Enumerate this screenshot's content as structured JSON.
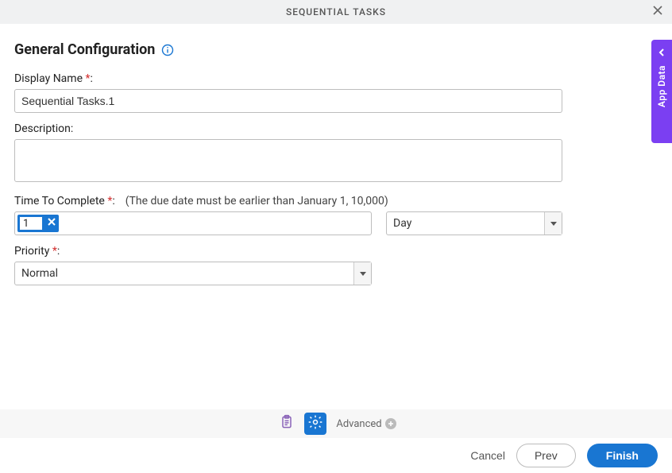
{
  "header": {
    "title": "SEQUENTIAL TASKS"
  },
  "section": {
    "title": "General Configuration"
  },
  "fields": {
    "display_name": {
      "label": "Display Name",
      "value": "Sequential Tasks.1"
    },
    "description": {
      "label": "Description:",
      "value": ""
    },
    "time_to_complete": {
      "label": "Time To Complete",
      "hint": "(The due date must be earlier than January 1, 10,000)",
      "value": "1",
      "unit": "Day"
    },
    "priority": {
      "label": "Priority",
      "value": "Normal"
    }
  },
  "toolbar": {
    "advanced_label": "Advanced"
  },
  "footer": {
    "cancel": "Cancel",
    "prev": "Prev",
    "finish": "Finish"
  },
  "side_tab": {
    "label": "App Data"
  },
  "colors": {
    "primary": "#1976d2",
    "accent": "#7b3ff2",
    "danger": "#d32f2f"
  }
}
